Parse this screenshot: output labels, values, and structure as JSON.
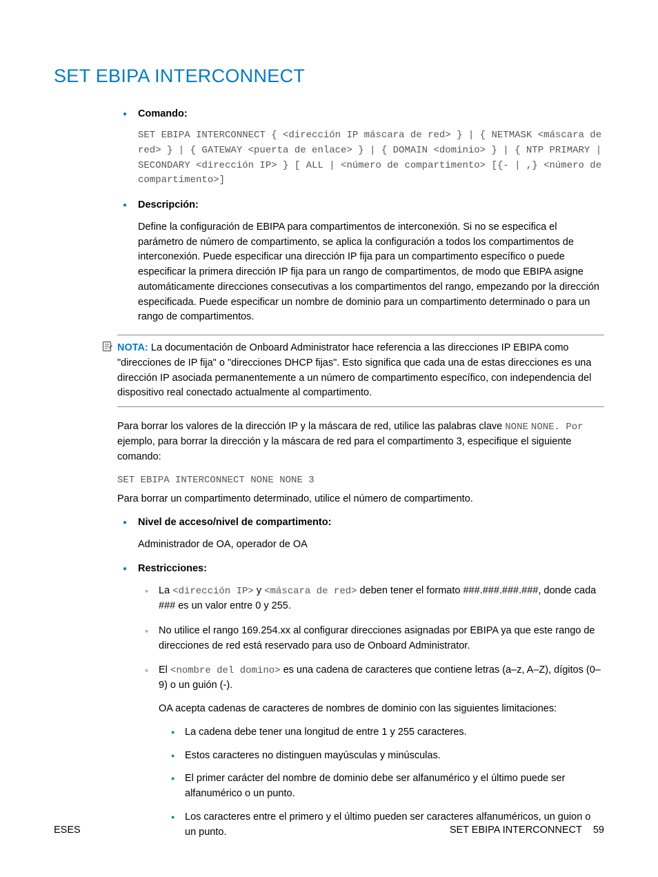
{
  "title": "SET EBIPA INTERCONNECT",
  "sections": {
    "comando": {
      "label": "Comando:",
      "code": "SET EBIPA INTERCONNECT { <dirección IP máscara de red> } | { NETMASK <máscara de red> } | { GATEWAY <puerta de enlace> } | { DOMAIN <dominio> } | { NTP PRIMARY | SECONDARY <dirección IP> } [ ALL | <número de compartimento> [{- | ,} <número de compartimento>]"
    },
    "descripcion": {
      "label": "Descripción:",
      "text": "Define la configuración de EBIPA para compartimentos de interconexión. Si no se especifica el parámetro de número de compartimento, se aplica la configuración a todos los compartimentos de interconexión. Puede especificar una dirección IP fija para un compartimento específico o puede especificar la primera dirección IP fija para un rango de compartimentos, de modo que EBIPA asigne automáticamente direcciones consecutivas a los compartimentos del rango, empezando por la dirección especificada. Puede especificar un nombre de dominio para un compartimento determinado o para un rango de compartimentos."
    },
    "nota": {
      "label": "NOTA:",
      "text": "La documentación de Onboard Administrator hace referencia a las direcciones IP EBIPA como \"direcciones de IP fija\" o \"direcciones DHCP fijas\". Esto significa que cada una de estas direcciones es una dirección IP asociada permanentemente a un número de compartimento específico, con independencia del dispositivo real conectado actualmente al compartimento."
    },
    "clear_para": {
      "pre": "Para borrar los valores de la dirección IP y la máscara de red, utilice las palabras clave ",
      "kw1": "NONE",
      "mid": " ",
      "kw2": "NONE",
      "dot": ". ",
      "kw3": "Por",
      "post": " ejemplo, para borrar la dirección y la máscara de red para el compartimento 3, especifique el siguiente comando:"
    },
    "clear_cmd": "SET EBIPA INTERCONNECT NONE NONE 3",
    "clear_bay": "Para borrar un compartimento determinado, utilice el número de compartimento.",
    "nivel": {
      "label": "Nivel de acceso/nivel de compartimento:",
      "text": "Administrador de OA, operador de OA"
    },
    "restricciones": {
      "label": "Restricciones:",
      "items": [
        {
          "pre": "La ",
          "code1": "<dirección IP>",
          "mid": " y ",
          "code2": "<máscara de red>",
          "post": " deben tener el formato ###.###.###.###, donde cada ### es un valor entre 0 y 255."
        },
        {
          "text": "No utilice el rango 169.254.xx al configurar direcciones asignadas por EBIPA ya que este rango de direcciones de red está reservado para uso de Onboard Administrator."
        },
        {
          "pre": "El ",
          "code1": "<nombre del domino>",
          "post": " es una cadena de caracteres que contiene letras (a–z, A–Z), dígitos (0–9) o un guión (-).",
          "para2": "OA acepta cadenas de caracteres de nombres de dominio con las siguientes limitaciones:",
          "sub": [
            "La cadena debe tener una longitud de entre 1 y 255 caracteres.",
            "Estos caracteres no distinguen mayúsculas y minúsculas.",
            "El primer carácter del nombre de dominio debe ser alfanumérico y el último puede ser alfanumérico o un punto.",
            "Los caracteres entre el primero y el último pueden ser caracteres alfanuméricos, un guion o un punto."
          ]
        }
      ]
    }
  },
  "footer": {
    "left": "ESES",
    "right_title": "SET EBIPA INTERCONNECT",
    "page": "59"
  }
}
